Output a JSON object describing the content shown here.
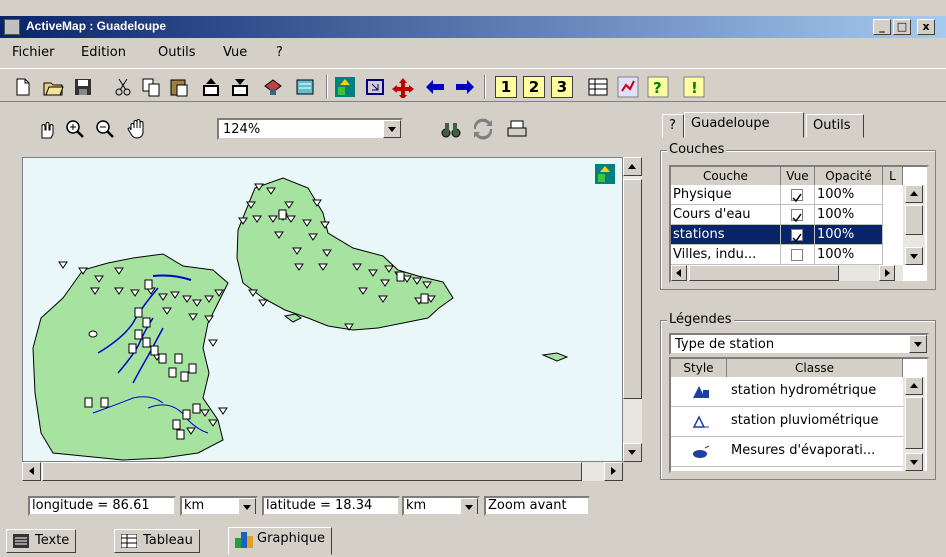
{
  "window": {
    "title": "ActiveMap : Guadeloupe",
    "minimize": "_",
    "maximize": "□",
    "close": "x"
  },
  "menu": [
    "Fichier",
    "Edition",
    "Outils",
    "Vue",
    "?"
  ],
  "map": {
    "zoom": "124%"
  },
  "right_panel": {
    "tabs": [
      "?",
      "Guadeloupe",
      "Outils"
    ],
    "couches": {
      "title": "Couches",
      "columns": [
        "Couche",
        "Vue",
        "Opacité",
        "L"
      ],
      "rows": [
        {
          "couche": "Physique",
          "vue": true,
          "opacite": "100%"
        },
        {
          "couche": "Cours d'eau",
          "vue": true,
          "opacite": "100%"
        },
        {
          "couche": "stations",
          "vue": true,
          "opacite": "100%",
          "selected": true
        },
        {
          "couche": "Villes, indu...",
          "vue": false,
          "opacite": "100%"
        }
      ]
    },
    "legendes": {
      "title": "Légendes",
      "type_select": "Type de station",
      "columns": [
        "Style",
        "Classe"
      ],
      "rows": [
        {
          "icon": "hydro-station-icon",
          "classe": "station hydrométrique"
        },
        {
          "icon": "rain-station-icon",
          "classe": "station pluviométrique"
        },
        {
          "icon": "evaporation-icon",
          "classe": "Mesures d'évaporati..."
        }
      ]
    }
  },
  "status": {
    "longitude": "longitude = 86.61",
    "lon_unit": "km",
    "latitude": "latitude = 18.34",
    "lat_unit": "km",
    "mode": "Zoom avant"
  },
  "bottom_tabs": [
    "Texte",
    "Tableau",
    "Graphique"
  ],
  "toolbar_right_labels": [
    "1",
    "2",
    "3"
  ],
  "colors": {
    "land": "#a6e3a0",
    "sea": "#eaf7f8",
    "river": "#0000cc",
    "selected": "#0a246a"
  }
}
